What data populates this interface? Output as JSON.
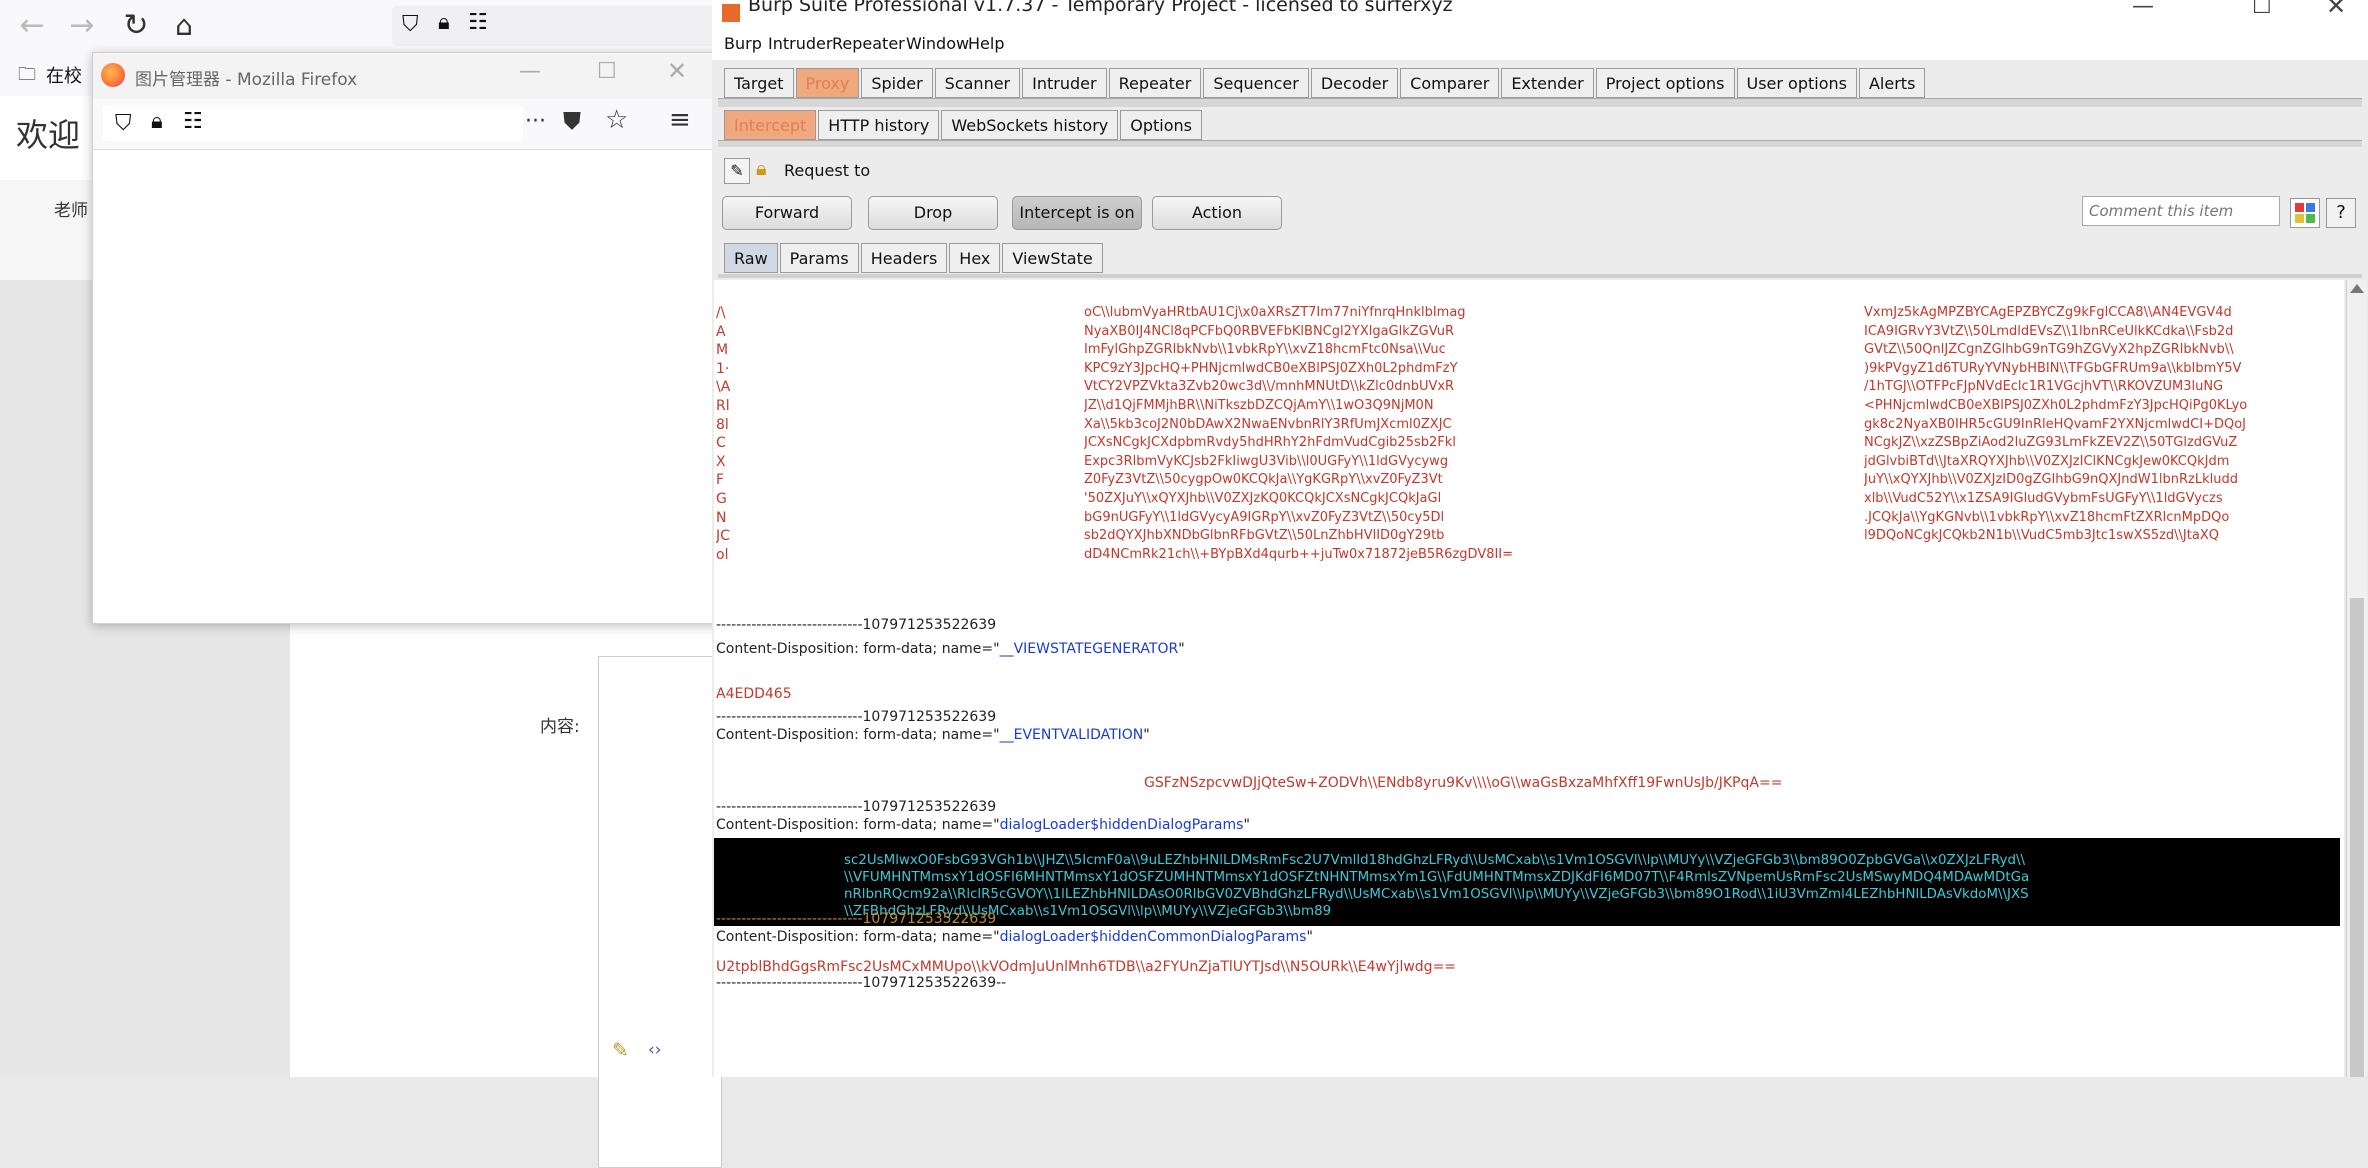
{
  "bg_firefox": {
    "bookmark_label": "在校",
    "welcome_text": "欢迎",
    "side_text": "老师",
    "field_label": "内容:"
  },
  "popup": {
    "title": "图片管理器 - Mozilla Firefox"
  },
  "burp": {
    "title": "Burp Suite Professional v1.7.37 - Temporary Project - licensed to surferxyz",
    "menu": [
      "Burp",
      "Intruder",
      "Repeater",
      "Window",
      "Help"
    ],
    "tabs": [
      "Target",
      "Proxy",
      "Spider",
      "Scanner",
      "Intruder",
      "Repeater",
      "Sequencer",
      "Decoder",
      "Comparer",
      "Extender",
      "Project options",
      "User options",
      "Alerts"
    ],
    "active_tab": "Proxy",
    "subtabs": [
      "Intercept",
      "HTTP history",
      "WebSockets history",
      "Options"
    ],
    "active_subtab": "Intercept",
    "request_to": "Request to",
    "buttons": {
      "forward": "Forward",
      "drop": "Drop",
      "intercept": "Intercept is on",
      "action": "Action"
    },
    "comment_placeholder": "Comment this item",
    "help": "?",
    "viewtabs": [
      "Raw",
      "Params",
      "Headers",
      "Hex",
      "ViewState"
    ],
    "active_viewtab": "Raw"
  },
  "body": {
    "viewstate_left": [
      "/\\",
      "A",
      "M",
      "1·",
      "\\A",
      "Rl",
      "8l",
      "C",
      "X",
      "F",
      "G",
      "N",
      "JC",
      "ol"
    ],
    "viewstate_mid": [
      "oC\\\\lubmVyaHRtbAU1Cj\\x0aXRsZT7Im77niYfnrqHnklbImag",
      "NyaXB0IJ4NCl8qPCFbQ0RBVEFbKlBNCgl2YXlgaGlkZGVuR",
      "ImFylGhpZGRlbkNvb\\\\1vbkRpY\\\\xvZ18hcmFtc0Nsa\\\\Vuc",
      "KPC9zY3JpcHQ+PHNjcmlwdCB0eXBlPSJ0ZXh0L2phdmFzY",
      "VtCY2VPZVkta3Zvb20wc3d\\\\/mnhMNUtD\\\\kZlc0dnbUVxR",
      "JZ\\\\d1QjFMMjhBR\\\\NiTkszbDZCQjAmY\\\\1wO3Q9NjM0N",
      "Xa\\\\5kb3coJ2N0bDAwX2NwaENvbnRlY3RfUmJXcml0ZXJC",
      "JCXsNCgkJCXdpbmRvdy5hdHRhY2hFdmVudCgib25sb2Fkl",
      "Expc3RlbmVyKCJsb2FkIiwgU3Vib\\\\l0UGFyY\\\\1ldGVycywg",
      "Z0FyZ3VtZ\\\\50cygpOw0KCQkJa\\\\YgKGRpY\\\\xvZ0FyZ3Vt",
      "'50ZXJuY\\\\xQYXJhb\\\\V0ZXJzKQ0KCQkJCXsNCgkJCQkJaGl",
      "bG9nUGFyY\\\\1ldGVycyA9IGRpY\\\\xvZ0FyZ3VtZ\\\\50cy5Dl",
      "sb2dQYXJhbXNDbGlbnRFbGVtZ\\\\50LnZhbHVlID0gY29tb",
      "dD4NCmRk21ch\\\\+BYpBXd4qurb++juTw0x71872jeB5R6zgDV8II="
    ],
    "viewstate_right": [
      "VxmJz5kAgMPZBYCAgEPZBYCZg9kFglCCA8\\\\AN4EVGV4d",
      "ICA9IGRvY3VtZ\\\\50LmdldEVsZ\\\\1lbnRCeUlkKCdka\\\\Fsb2d",
      "GVtZ\\\\50QnlJZCgnZGlhbG9nTG9hZGVyX2hpZGRlbkNvb\\\\",
      ")9kPVgyZ1d6TURyYVNybHBIN\\\\TFGbGFRUm9a\\\\kbIbmY5V",
      "/1hTGJ\\\\OTFPcFJpNVdEclc1R1VGcjhVT\\\\RKOVZUM3luNG",
      "<PHNjcmlwdCB0eXBlPSJ0ZXh0L2phdmFzY3JpcHQiPg0KLyo",
      "gk8c2NyaXB0IHR5cGU9InRleHQvamF2YXNjcmlwdCI+DQoJ",
      "NCgkJZ\\\\xzZSBpZiAod2luZG93LmFkZEV2Z\\\\50TGlzdGVuZ",
      "jdGlvbiBTd\\\\JtaXRQYXJhb\\\\V0ZXJzIClKNCgkJew0KCQkJdm",
      "JuY\\\\xQYXJhb\\\\V0ZXJzID0gZGlhbG9nQXJndW1lbnRzLkludd",
      "xlb\\\\VudC52Y\\\\x1ZSA9IGludGVybmFsUGFyY\\\\1ldGVyczs",
      ".JCQkJa\\\\YgKGNvb\\\\1vbkRpY\\\\xvZ18hcmFtZXRlcnMpDQo",
      "l9DQoNCgkJCQkb2N1b\\\\VudC5mb3Jtc1swXS5zd\\\\JtaXQ"
    ],
    "boundary": "-----------------------------10797125352263­9",
    "boundary_end": "-----------------------------107971253522639--",
    "disp1": "Content-Disposition: form-data; name=\"",
    "name1": "__VIEWSTATEGENERATOR",
    "val1": "A4EDD465",
    "name2": "__EVENTVALIDATION",
    "val2": "GSFzNSzpcvwDJjQteSw+ZODVh\\\\ENdb8yru9Kv\\\\\\\\oG\\\\waGsBxzaMhfXff19FwnUsJb/JKPqA==",
    "name3": "dialogLoader$hiddenDialogParams",
    "selected": [
      "sc2UsMlwxO0FsbG93VGh1b\\\\JHZ\\\\5IcmF0a\\\\9uLEZhbHNlLDMsRmFsc2U7Vmlld18hdGhzLFRyd\\\\UsMCxab\\\\s1Vm1OSGVl\\\\lp\\\\MUYy\\\\VZjeGFGb3\\\\bm89O0ZpbGVGa\\\\x0ZXJzLFRyd\\\\",
      "\\\\VFUMHNTMmsxY1dOSFI6MHNTMmsxY1dOSFZUMHNTMmsxY1dOSFZtNHNTMmsxYm1G\\\\FdUMHNTMmsxZDJKdFI6MD07T\\\\F4RmlsZVNpemUsRmFsc2UsMSwyMDQ4MDAwMDtGa",
      "nRlbnRQcm92a\\\\RlclR5cGVOY\\\\1lLEZhbHNlLDAsO0RlbGV0ZVBhdGhzLFRyd\\\\UsMCxab\\\\s1Vm1OSGVl\\\\lp\\\\MUYy\\\\VZjeGFGb3\\\\bm89O1Rod\\\\1iU3VmZml4LEZhbHNlLDAsVkdoM\\\\JXS",
      "\\\\ZFBhdGhzLFRyd\\\\UsMCxab\\\\s1Vm1OSGVl\\\\lp\\\\MUYy\\\\VZjeGFGb3\\\\bm89"
    ],
    "name4": "dialogLoader$hiddenCommonDialogParams",
    "val4": "U2tpblBhdGgsRmFsc2UsMCxMMUpo\\\\kVOdmJuUnlMnh6TDB\\\\a2FYUnZjaTlUYTJsd\\\\N5OURk\\\\E4wYjlwdg=="
  }
}
